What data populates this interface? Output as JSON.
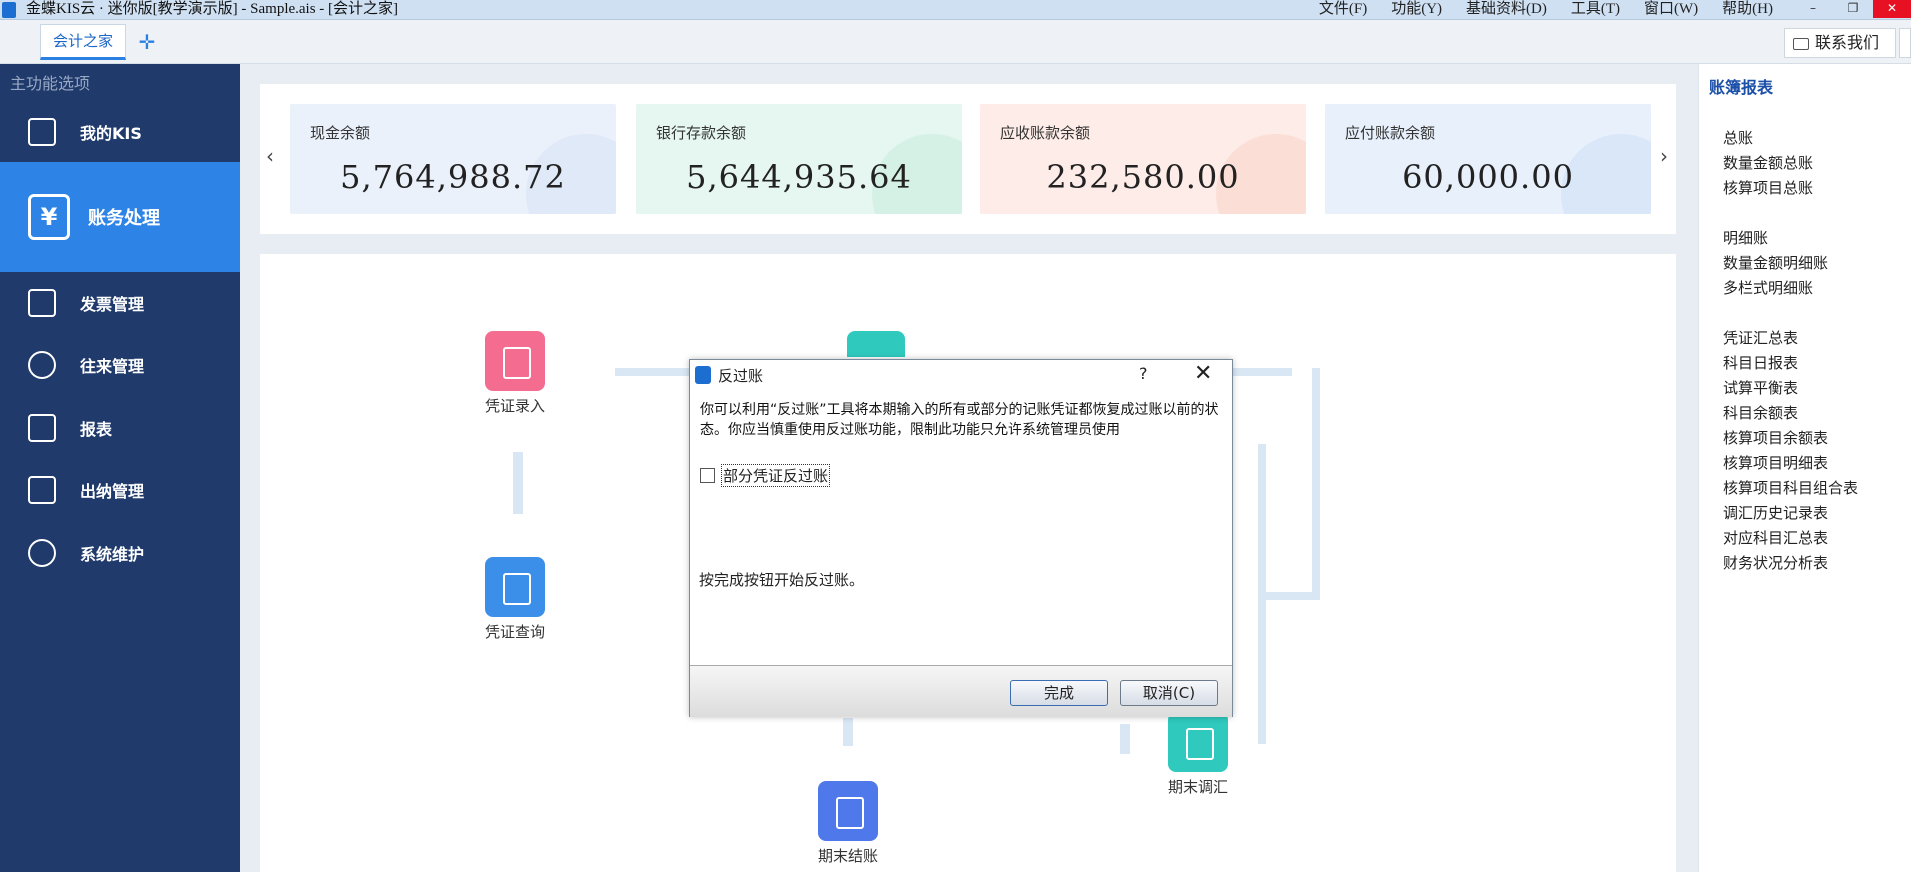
{
  "window": {
    "title": "金蝶KIS云 · 迷你版[教学演示版] - Sample.ais - [会计之家]",
    "menu": [
      "文件(F)",
      "功能(Y)",
      "基础资料(D)",
      "工具(T)",
      "窗口(W)",
      "帮助(H)"
    ],
    "controls": {
      "minimize": "–",
      "restore": "❐",
      "close": "✕"
    }
  },
  "tabs": {
    "active": "会计之家",
    "add": "✛"
  },
  "contact": {
    "label": "联系我们"
  },
  "sidebar": {
    "header": "主功能选项",
    "items": [
      {
        "label": "我的KIS",
        "icon": "monitor-icon"
      },
      {
        "label": "账务处理",
        "icon": "yen-shield-icon",
        "glyph": "¥"
      },
      {
        "label": "发票管理",
        "icon": "invoice-icon"
      },
      {
        "label": "往来管理",
        "icon": "exchange-icon"
      },
      {
        "label": "报表",
        "icon": "presentation-icon"
      },
      {
        "label": "出纳管理",
        "icon": "cash-icon"
      },
      {
        "label": "系统维护",
        "icon": "cycle-icon"
      }
    ]
  },
  "summary": {
    "prev": "‹",
    "next": "›",
    "cards": [
      {
        "caption": "现金余额",
        "value": "5,764,988.72",
        "bg": "#eaf1fb",
        "deco": "#d3e2f6"
      },
      {
        "caption": "银行存款余额",
        "value": "5,644,935.64",
        "bg": "#e6f6f1",
        "deco": "#c4ebdc"
      },
      {
        "caption": "应收账款余额",
        "value": "232,580.00",
        "bg": "#fdece7",
        "deco": "#f9d2c6"
      },
      {
        "caption": "应付账款余额",
        "value": "60,000.00",
        "bg": "#e7f0fb",
        "deco": "#cbdef6"
      }
    ]
  },
  "flow": {
    "nodes": [
      {
        "label": "凭证录入",
        "color": "#f46c8f"
      },
      {
        "label": "凭证查询",
        "color": "#3c8fe8"
      },
      {
        "label": "期末调汇",
        "color": "#2fc9bd"
      },
      {
        "label": "期末结账",
        "color": "#4f79ea"
      }
    ]
  },
  "right_panel": {
    "title": "账簿报表",
    "groups": [
      [
        "总账",
        "数量金额总账",
        "核算项目总账"
      ],
      [
        "明细账",
        "数量金额明细账",
        "多栏式明细账"
      ],
      [
        "凭证汇总表",
        "科目日报表",
        "试算平衡表",
        "科目余额表",
        "核算项目余额表",
        "核算项目明细表",
        "核算项目科目组合表",
        "调汇历史记录表",
        "对应科目汇总表",
        "财务状况分析表"
      ]
    ]
  },
  "dialog": {
    "title": "反过账",
    "help": "?",
    "close": "✕",
    "description": "你可以利用“反过账”工具将本期输入的所有或部分的记账凭证都恢复成过账以前的状态。你应当慎重使用反过账功能，限制此功能只允许系统管理员使用",
    "checkbox_label": "部分凭证反过账",
    "checkbox_checked": false,
    "hint": "按完成按钮开始反过账。",
    "ok_label": "完成",
    "cancel_label": "取消(C)"
  }
}
